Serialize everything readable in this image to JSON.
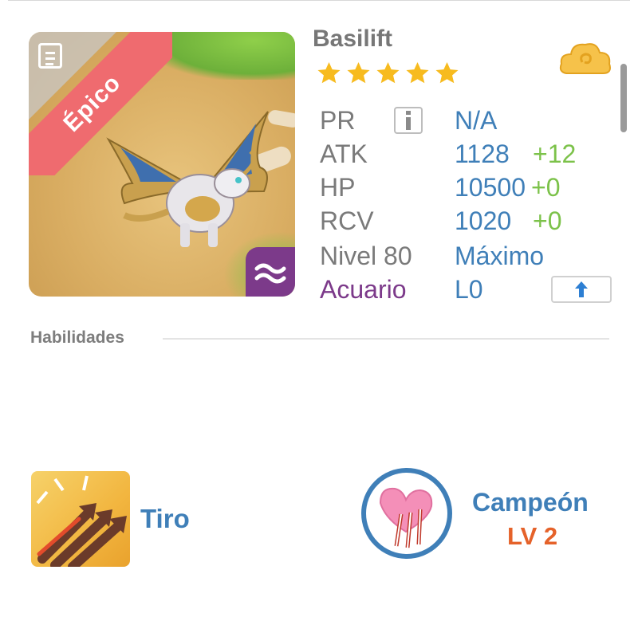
{
  "dragon": {
    "name": "Basilift",
    "rarity": "Épico",
    "stars": 5,
    "element_icon": "wave-icon",
    "type_icon": "cloud-icon"
  },
  "stats": {
    "pr": {
      "label": "PR",
      "value": "N/A"
    },
    "atk": {
      "label": "ATK",
      "value": "1128",
      "bonus": "+12"
    },
    "hp": {
      "label": "HP",
      "value": "10500",
      "bonus": "+0"
    },
    "rcv": {
      "label": "RCV",
      "value": "1020",
      "bonus": "+0"
    },
    "level": {
      "label": "Nivel 80",
      "value": "Máximo"
    },
    "sign": {
      "label": "Acuario",
      "value": "L0"
    }
  },
  "skills_section": {
    "title": "Habilidades"
  },
  "skills": {
    "primary": {
      "name": "Tiro",
      "icon": "arrows-icon"
    },
    "secondary": {
      "name": "Campeón",
      "level": "LV 2",
      "icon": "heart-claw-icon"
    }
  },
  "colors": {
    "accent_blue": "#3f7fb8",
    "bonus_green": "#7cc24a",
    "rarity_red": "#ef6b6f",
    "sign_purple": "#7c3a8a",
    "level_orange": "#e5622a"
  }
}
